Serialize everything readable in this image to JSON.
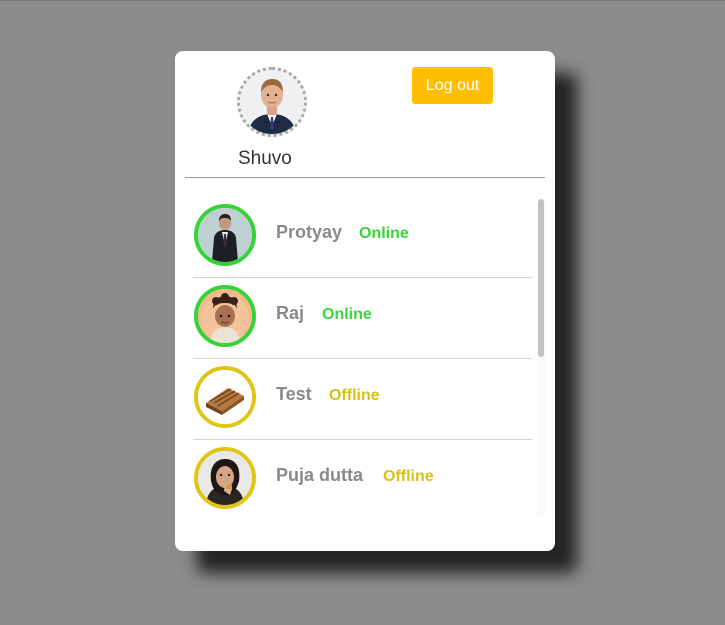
{
  "current_user": {
    "name": "Shuvo",
    "avatar_icon": "user-photo-icon"
  },
  "header": {
    "logout_label": "Log out"
  },
  "colors": {
    "online": "#3ad43a",
    "offline": "#d9c112",
    "accent": "#ffbf00",
    "background": "#8c8c8c"
  },
  "contacts": [
    {
      "name": "Protyay",
      "status": "Online",
      "avatar_icon": "man-in-suit-photo-icon"
    },
    {
      "name": "Raj",
      "status": "Online",
      "avatar_icon": "child-photo-icon"
    },
    {
      "name": "Test",
      "status": "Offline",
      "avatar_icon": "wooden-crate-photo-icon"
    },
    {
      "name": "Puja dutta",
      "status": "Offline",
      "avatar_icon": "woman-photo-icon"
    }
  ]
}
